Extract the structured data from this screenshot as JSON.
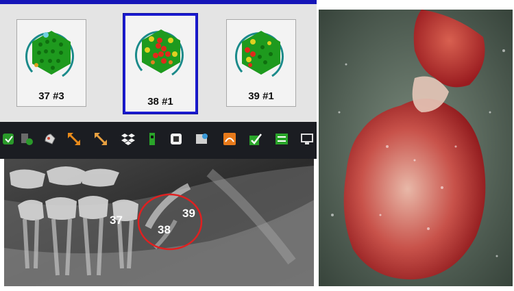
{
  "thumbnails": [
    {
      "label": "37 #3",
      "selected": false
    },
    {
      "label": "38 #1",
      "selected": true
    },
    {
      "label": "39 #1",
      "selected": false
    }
  ],
  "toolbar": {
    "icons": [
      "check-icon",
      "user-check-icon",
      "hand-icon",
      "resize-icon",
      "resize-alt-icon",
      "dropbox-icon",
      "scan-icon",
      "reader-icon",
      "patient-card-icon",
      "image-export-icon",
      "approve-icon",
      "transfer-icon",
      "monitor-icon"
    ]
  },
  "xray": {
    "tooth_labels": [
      "37",
      "38",
      "39"
    ],
    "circle_color": "#e02020"
  },
  "colors": {
    "selection_border": "#1a1ad0",
    "healthy": "#1e9a1e",
    "warning": "#e0d020",
    "alert": "#e02a1a"
  }
}
